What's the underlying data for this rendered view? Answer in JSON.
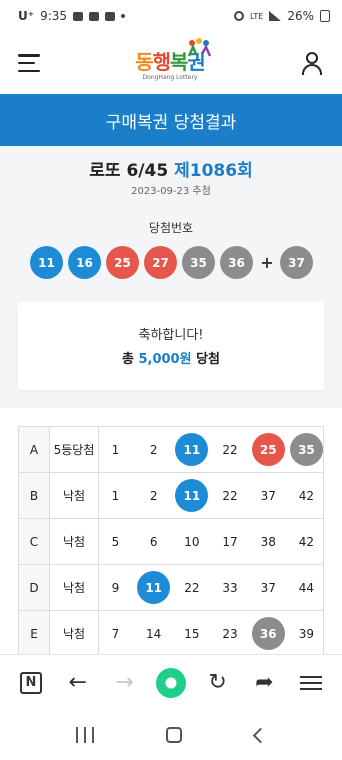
{
  "status_bar": {
    "carrier": "U⁺",
    "time": "9:35",
    "network": "LTE",
    "battery": "26%"
  },
  "header": {
    "logo_text": [
      "동",
      "행",
      "복",
      "권"
    ],
    "logo_sub": "DongHang Lottery"
  },
  "title_bar": {
    "title": "구매복권 당첨결과"
  },
  "summary": {
    "game_name": "로또 6/45",
    "round": "제1086회",
    "draw_date": "2023-09-23 추첨",
    "winning_label": "당첨번호",
    "winning_numbers": [
      {
        "value": "11",
        "color": "blue"
      },
      {
        "value": "16",
        "color": "blue"
      },
      {
        "value": "25",
        "color": "red"
      },
      {
        "value": "27",
        "color": "red"
      },
      {
        "value": "35",
        "color": "gray"
      },
      {
        "value": "36",
        "color": "gray"
      }
    ],
    "plus": "+",
    "bonus_number": {
      "value": "37",
      "color": "gray"
    },
    "congrats": "축하합니다!",
    "prize_prefix": "총",
    "prize_amount": "5,000원",
    "prize_suffix": "당첨"
  },
  "tickets": [
    {
      "slot": "A",
      "rank": "5등당첨",
      "numbers": [
        {
          "v": "1",
          "m": ""
        },
        {
          "v": "2",
          "m": ""
        },
        {
          "v": "11",
          "m": "blue"
        },
        {
          "v": "22",
          "m": ""
        },
        {
          "v": "25",
          "m": "red"
        },
        {
          "v": "35",
          "m": "gray"
        }
      ]
    },
    {
      "slot": "B",
      "rank": "낙첨",
      "numbers": [
        {
          "v": "1",
          "m": ""
        },
        {
          "v": "2",
          "m": ""
        },
        {
          "v": "11",
          "m": "blue"
        },
        {
          "v": "22",
          "m": ""
        },
        {
          "v": "37",
          "m": ""
        },
        {
          "v": "42",
          "m": ""
        }
      ]
    },
    {
      "slot": "C",
      "rank": "낙첨",
      "numbers": [
        {
          "v": "5",
          "m": ""
        },
        {
          "v": "6",
          "m": ""
        },
        {
          "v": "10",
          "m": ""
        },
        {
          "v": "17",
          "m": ""
        },
        {
          "v": "38",
          "m": ""
        },
        {
          "v": "42",
          "m": ""
        }
      ]
    },
    {
      "slot": "D",
      "rank": "낙첨",
      "numbers": [
        {
          "v": "9",
          "m": ""
        },
        {
          "v": "11",
          "m": "blue"
        },
        {
          "v": "22",
          "m": ""
        },
        {
          "v": "33",
          "m": ""
        },
        {
          "v": "37",
          "m": ""
        },
        {
          "v": "44",
          "m": ""
        }
      ]
    },
    {
      "slot": "E",
      "rank": "낙첨",
      "numbers": [
        {
          "v": "7",
          "m": ""
        },
        {
          "v": "14",
          "m": ""
        },
        {
          "v": "15",
          "m": ""
        },
        {
          "v": "23",
          "m": ""
        },
        {
          "v": "36",
          "m": "gray"
        },
        {
          "v": "39",
          "m": ""
        }
      ]
    }
  ],
  "browser_bar": {
    "n_icon": "N",
    "back": "←",
    "forward": "→",
    "reload": "↻",
    "share": "➦"
  },
  "colors": {
    "accent": "#1a7fc8",
    "ball_blue": "#1e8bd6",
    "ball_red": "#e5574d",
    "ball_gray": "#8c8c8c"
  }
}
